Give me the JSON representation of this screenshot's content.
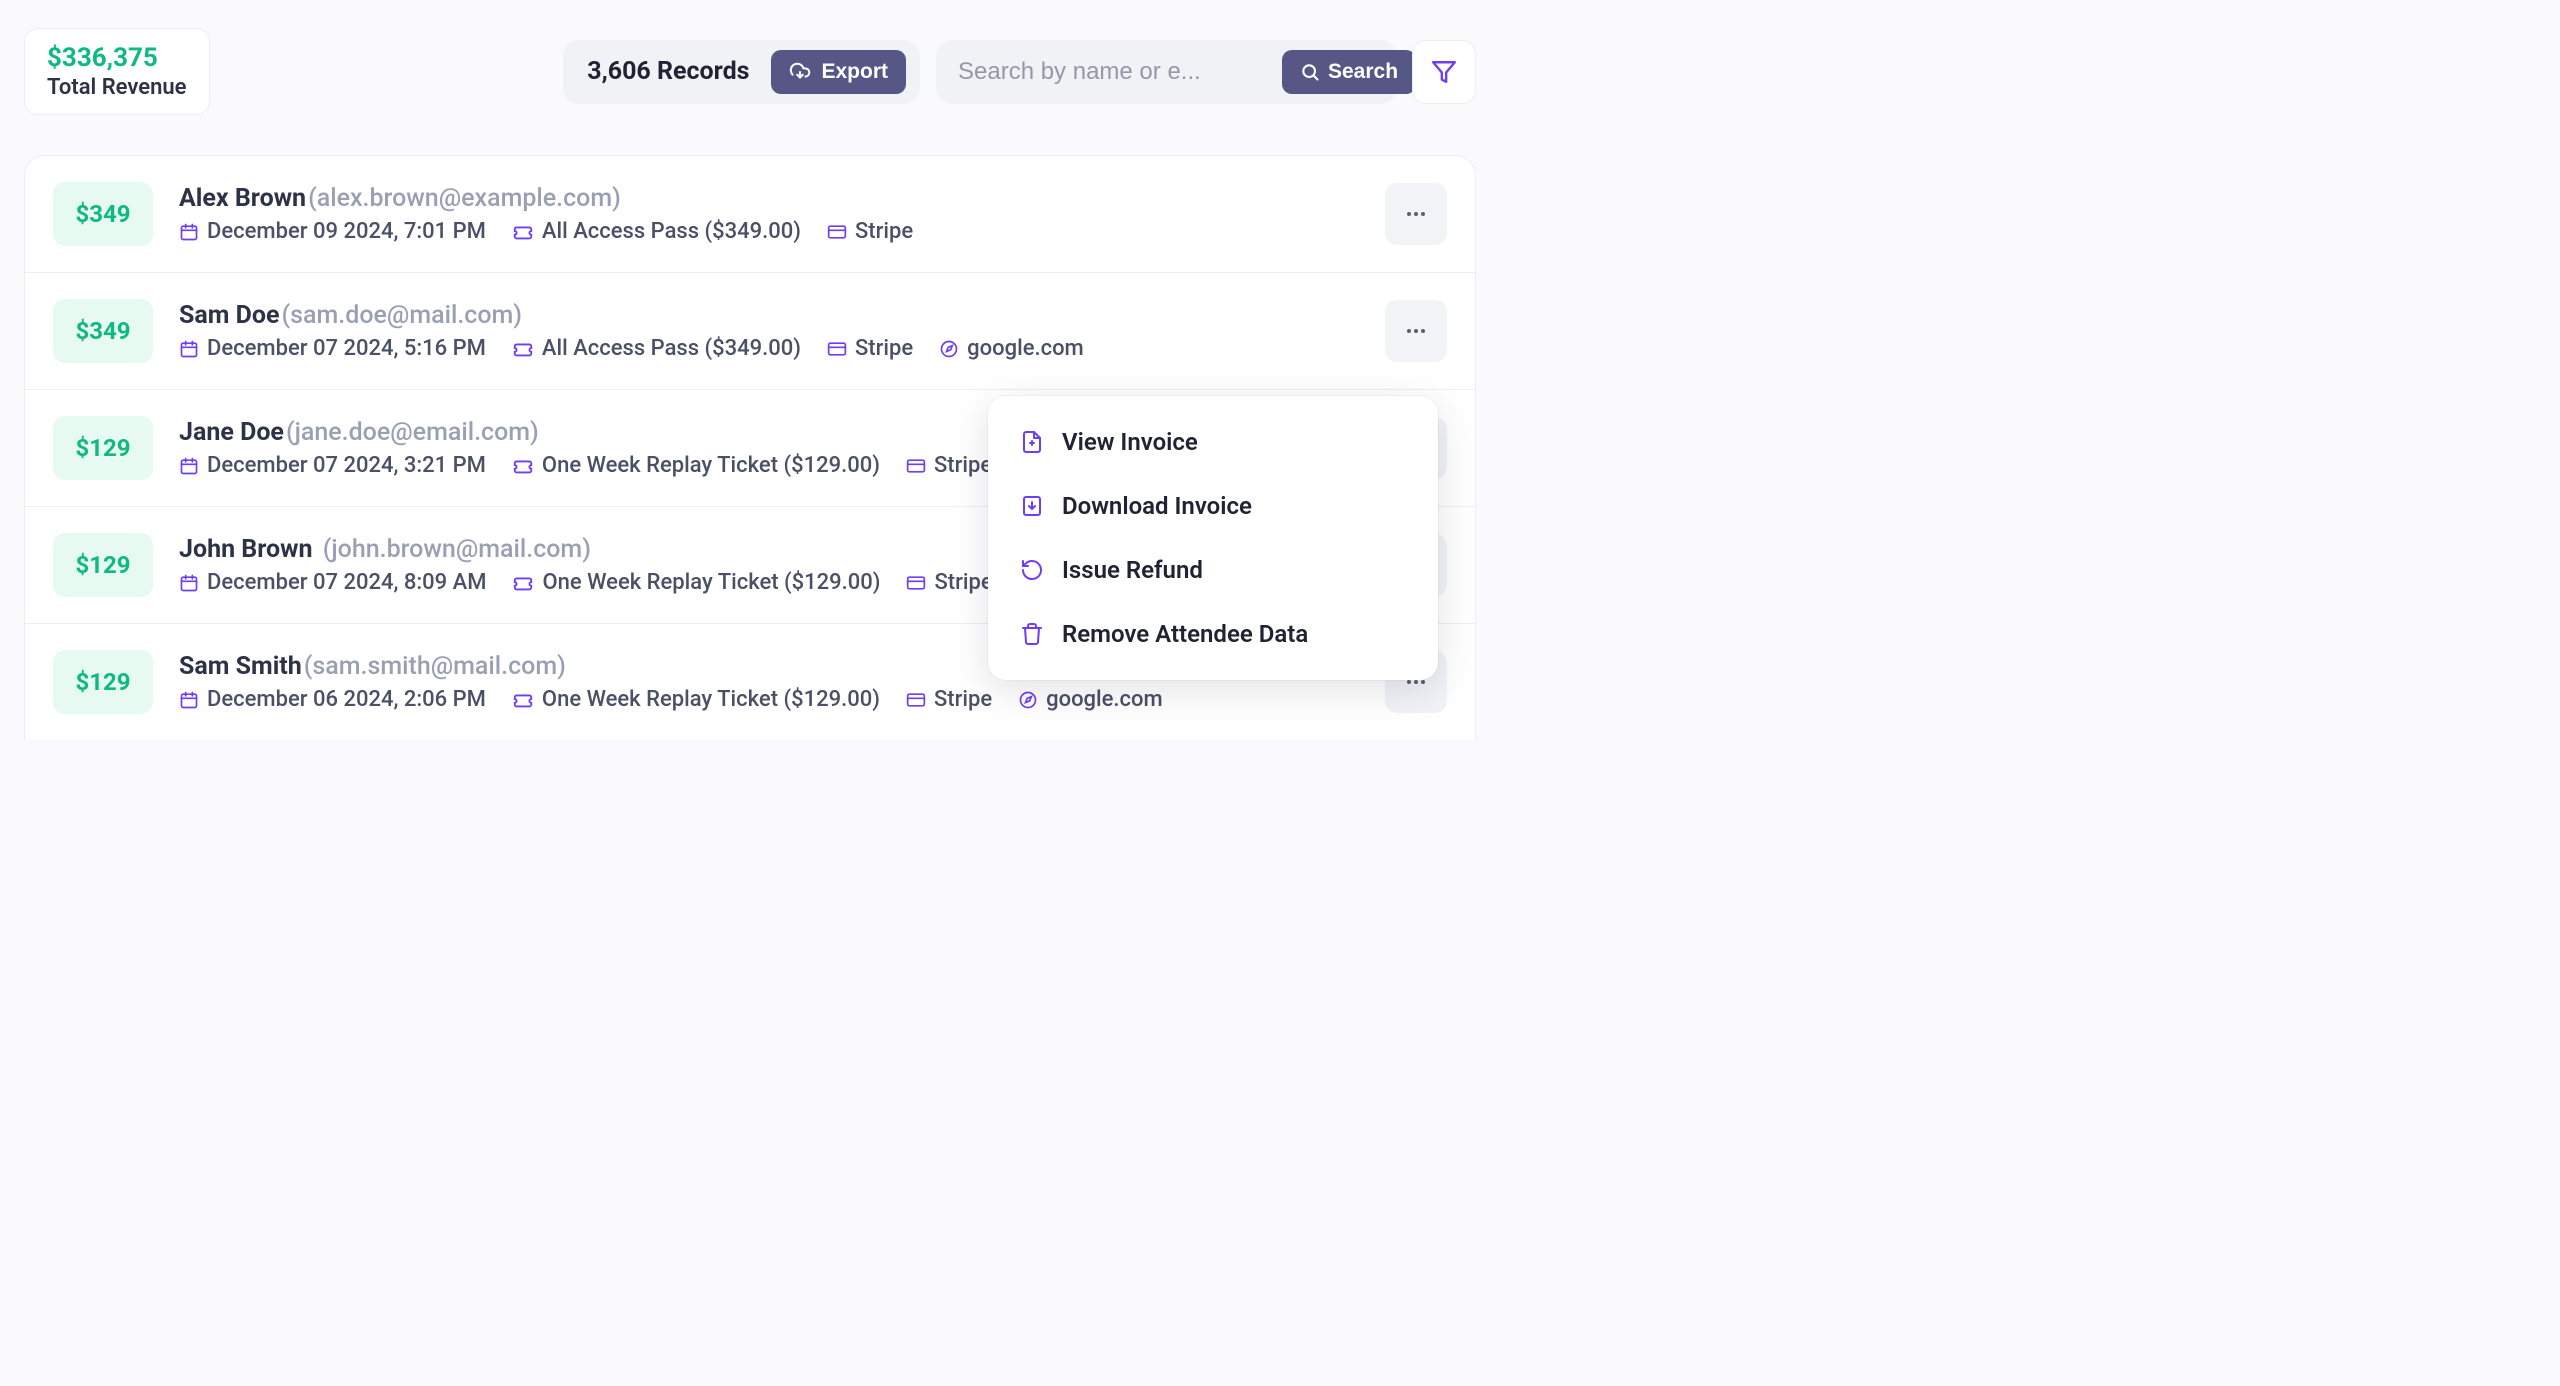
{
  "header": {
    "revenue_amount": "$336,375",
    "revenue_label": "Total Revenue",
    "records_text": "3,606 Records",
    "export_label": "Export",
    "search_placeholder": "Search by name or e...",
    "search_label": "Search"
  },
  "rows": [
    {
      "amount": "$349",
      "name": "Alex Brown",
      "email": "(alex.brown@example.com)",
      "date": "December 09 2024, 7:01 PM",
      "ticket": "All Access Pass ($349.00)",
      "payment": "Stripe",
      "source": ""
    },
    {
      "amount": "$349",
      "name": "Sam Doe",
      "email": "(sam.doe@mail.com)",
      "date": "December 07 2024, 5:16 PM",
      "ticket": "All Access Pass ($349.00)",
      "payment": "Stripe",
      "source": "google.com"
    },
    {
      "amount": "$129",
      "name": "Jane Doe",
      "email": "(jane.doe@email.com)",
      "date": "December 07 2024, 3:21 PM",
      "ticket": "One Week Replay Ticket ($129.00)",
      "payment": "Stripe",
      "source": ""
    },
    {
      "amount": "$129",
      "name": "John Brown",
      "email": "(john.brown@mail.com)",
      "date": "December 07 2024, 8:09 AM",
      "ticket": "One Week Replay Ticket ($129.00)",
      "payment": "Stripe",
      "source": ""
    },
    {
      "amount": "$129",
      "name": "Sam Smith",
      "email": "(sam.smith@mail.com)",
      "date": "December 06 2024, 2:06 PM",
      "ticket": "One Week Replay Ticket ($129.00)",
      "payment": "Stripe",
      "source": "google.com"
    }
  ],
  "dropdown": {
    "view_invoice": "View Invoice",
    "download_invoice": "Download Invoice",
    "issue_refund": "Issue Refund",
    "remove_attendee": "Remove Attendee Data"
  }
}
